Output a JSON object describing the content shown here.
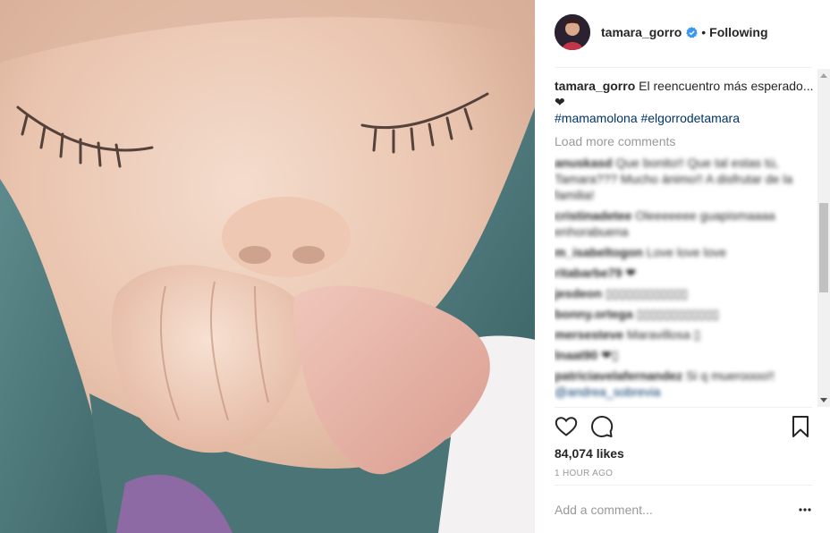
{
  "post": {
    "username": "tamara_gorro",
    "follow_status": "Following",
    "separator": "•"
  },
  "caption": {
    "username": "tamara_gorro",
    "text": "El reencuentro más esperado... ❤",
    "hashtags": "#mamamolona #elgorrodetamara"
  },
  "load_more": "Load more comments",
  "comments": [
    {
      "user": "anuskasd",
      "text": "Que bonito!! Que tal estas tú, Tamara??? Mucho ánimo!! A disfrutar de la familia!"
    },
    {
      "user": "cristinadetee",
      "text": "Oleeeeeee guapismaaaa enhorabuena"
    },
    {
      "user": "m_isabeltogon",
      "text": "Love love love"
    },
    {
      "user": "ritabarbe79",
      "text": "❤"
    },
    {
      "user": "jesdeon",
      "text": "▯▯▯▯▯▯▯▯▯▯▯▯"
    },
    {
      "user": "bonny.ortega",
      "text": "▯▯▯▯▯▯▯▯▯▯▯▯"
    },
    {
      "user": "mersesteve",
      "text": "Maravillosa ▯"
    },
    {
      "user": "lnaat90",
      "text": "❤▯"
    },
    {
      "user": "patriciavelafernandez",
      "text": "Si q mueroooo!!"
    },
    {
      "user": "",
      "text": "",
      "link": "@andrea_sobrevia"
    }
  ],
  "likes": "84,074 likes",
  "time_ago": "1 HOUR AGO",
  "add_comment_placeholder": "Add a comment...",
  "more_label": "•••",
  "colors": {
    "link": "#003569",
    "muted": "#999999",
    "verified": "#3897f0",
    "text": "#262626"
  },
  "icons": [
    "verified-badge-icon",
    "heart-icon",
    "comment-icon",
    "bookmark-icon",
    "more-options-icon"
  ]
}
